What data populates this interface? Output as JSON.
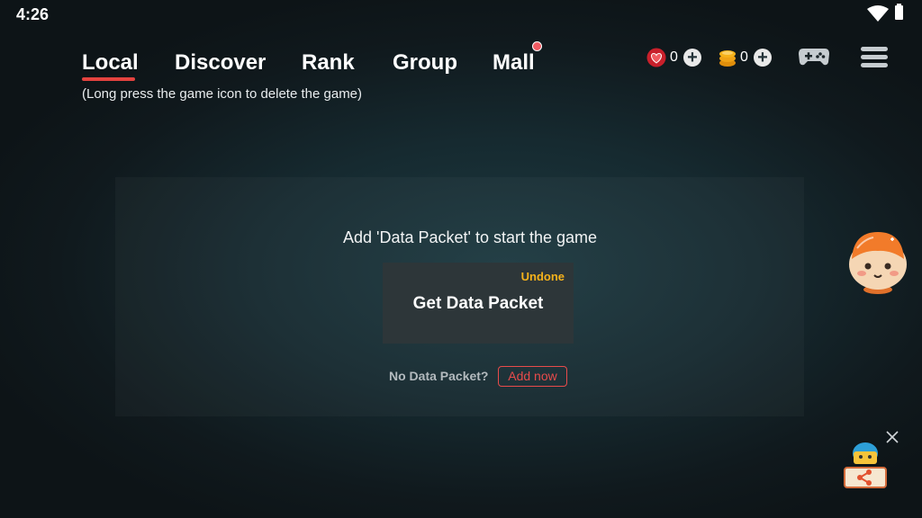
{
  "status_bar": {
    "time": "4:26"
  },
  "tabs": [
    {
      "label": "Local"
    },
    {
      "label": "Discover"
    },
    {
      "label": "Rank"
    },
    {
      "label": "Group"
    },
    {
      "label": "Mall"
    }
  ],
  "hint": "(Long press the game icon to delete the game)",
  "currency": {
    "hearts": "0",
    "coins": "0"
  },
  "panel": {
    "title": "Add 'Data Packet' to start the game",
    "card_status": "Undone",
    "card_label": "Get Data Packet",
    "no_packet_text": "No Data Packet?",
    "add_now_label": "Add now"
  },
  "colors": {
    "accent": "#e4433f",
    "status_orange": "#f6b21b",
    "card_bg": "#2d3639"
  },
  "icons": [
    "wifi-icon",
    "battery-icon",
    "heart-icon",
    "coin-icon",
    "plus-icon",
    "gamepad-icon",
    "menu-icon",
    "mascot-icon",
    "close-icon"
  ]
}
